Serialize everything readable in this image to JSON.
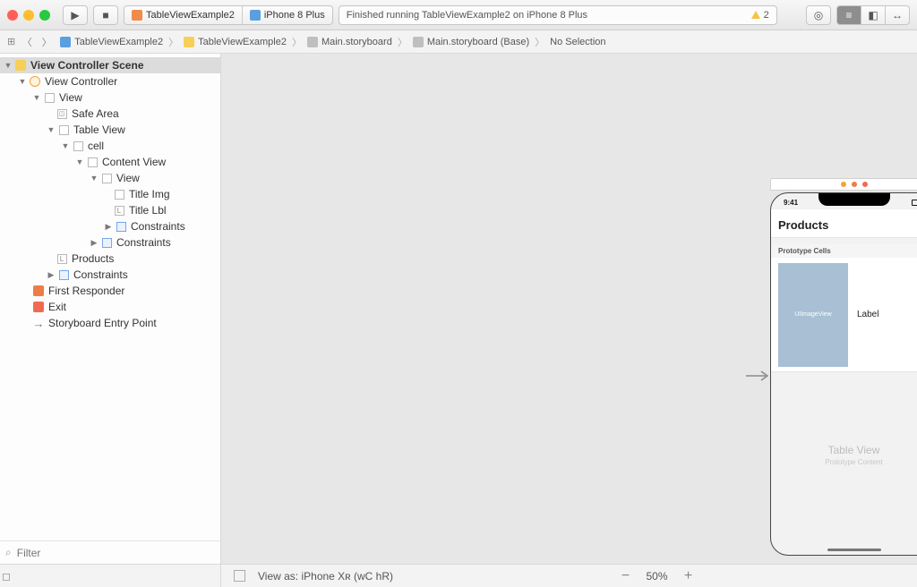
{
  "toolbar": {
    "scheme": {
      "target": "TableViewExample2",
      "device": "iPhone 8 Plus"
    },
    "status_text": "Finished running TableViewExample2 on iPhone 8 Plus",
    "warning_count": "2"
  },
  "breadcrumb": {
    "items": [
      "TableViewExample2",
      "TableViewExample2",
      "Main.storyboard",
      "Main.storyboard (Base)",
      "No Selection"
    ]
  },
  "tree": {
    "scene": "View Controller Scene",
    "vc": "View Controller",
    "view": "View",
    "safe_area": "Safe Area",
    "table_view": "Table View",
    "cell": "cell",
    "content_view": "Content View",
    "view2": "View",
    "title_img": "Title Img",
    "title_lbl": "Title Lbl",
    "constraints1": "Constraints",
    "constraints2": "Constraints",
    "products_lbl": "Products",
    "constraints3": "Constraints",
    "first_responder": "First Responder",
    "exit": "Exit",
    "entry_point": "Storyboard Entry Point"
  },
  "filter": {
    "placeholder": "Filter"
  },
  "phone": {
    "time": "9:41",
    "nav_title": "Products",
    "proto_header": "Prototype Cells",
    "img_placeholder": "UIImageView",
    "cell_label": "Label",
    "tv_title": "Table View",
    "tv_sub": "Prototype Content"
  },
  "bottombar": {
    "view_as": "View as: iPhone Xʀ (wC hR)",
    "zoom": "50%"
  }
}
